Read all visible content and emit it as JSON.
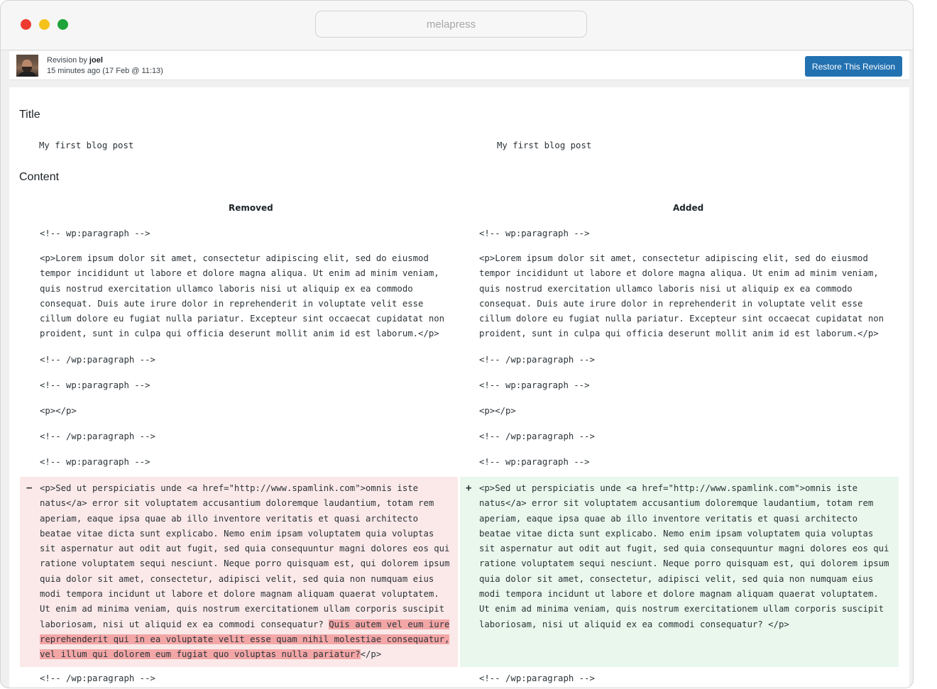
{
  "browser": {
    "url": "melapress"
  },
  "revision": {
    "prefix": "Revision by ",
    "author": "joel",
    "time_ago": "15 minutes ago",
    "timestamp": "(17 Feb @ 11:13)",
    "restore_label": "Restore This Revision"
  },
  "diff": {
    "title_heading": "Title",
    "title_left": "My first blog post",
    "title_right": "My first blog post",
    "content_heading": "Content",
    "removed_label": "Removed",
    "added_label": "Added",
    "lines": {
      "wp_open": "<!-- wp:paragraph -->",
      "wp_close": "<!-- /wp:paragraph -->",
      "empty_p": "<p></p>",
      "lorem": "<p>Lorem ipsum dolor sit amet, consectetur adipiscing elit, sed do eiusmod\ntempor incididunt ut labore et dolore magna aliqua. Ut enim ad minim veniam,\nquis nostrud exercitation ullamco laboris nisi ut aliquip ex ea commodo\nconsequat. Duis aute irure dolor in reprehenderit in voluptate velit esse\ncillum dolore eu fugiat nulla pariatur. Excepteur sint occaecat cupidatat non\nproident, sunt in culpa qui officia deserunt mollit anim id est laborum.</p>"
    },
    "removed_sign": "−",
    "added_sign": "+",
    "removed_block_start": "<p>Sed ut perspiciatis unde <a href=\"http://www.spamlink.com\">omnis iste\nnatus</a> error sit voluptatem accusantium doloremque laudantium, totam rem\naperiam, eaque ipsa quae ab illo inventore veritatis et quasi architecto\nbeatae vitae dicta sunt explicabo. Nemo enim ipsam voluptatem quia voluptas\nsit aspernatur aut odit aut fugit, sed quia consequuntur magni dolores eos qui\nratione voluptatem sequi nesciunt. Neque porro quisquam est, qui dolorem ipsum\nquia dolor sit amet, consectetur, adipisci velit, sed quia non numquam eius\nmodi tempora incidunt ut labore et dolore magnam aliquam quaerat voluptatem.\nUt enim ad minima veniam, quis nostrum exercitationem ullam corporis suscipit\nlaboriosam, nisi ut aliquid ex ea commodi consequatur? ",
    "removed_highlight": "Quis autem vel eum iure\nreprehenderit qui in ea voluptate velit esse quam nihil molestiae consequatur,\nvel illum qui dolorem eum fugiat quo voluptas nulla pariatur?",
    "removed_block_end": "</p>",
    "added_block": "<p>Sed ut perspiciatis unde <a href=\"http://www.spamlink.com\">omnis iste\nnatus</a> error sit voluptatem accusantium doloremque laudantium, totam rem\naperiam, eaque ipsa quae ab illo inventore veritatis et quasi architecto\nbeatae vitae dicta sunt explicabo. Nemo enim ipsam voluptatem quia voluptas\nsit aspernatur aut odit aut fugit, sed quia consequuntur magni dolores eos qui\nratione voluptatem sequi nesciunt. Neque porro quisquam est, qui dolorem ipsum\nquia dolor sit amet, consectetur, adipisci velit, sed quia non numquam eius\nmodi tempora incidunt ut labore et dolore magnam aliquam quaerat voluptatem.\nUt enim ad minima veniam, quis nostrum exercitationem ullam corporis suscipit\nlaboriosam, nisi ut aliquid ex ea commodi consequatur? </p>"
  }
}
